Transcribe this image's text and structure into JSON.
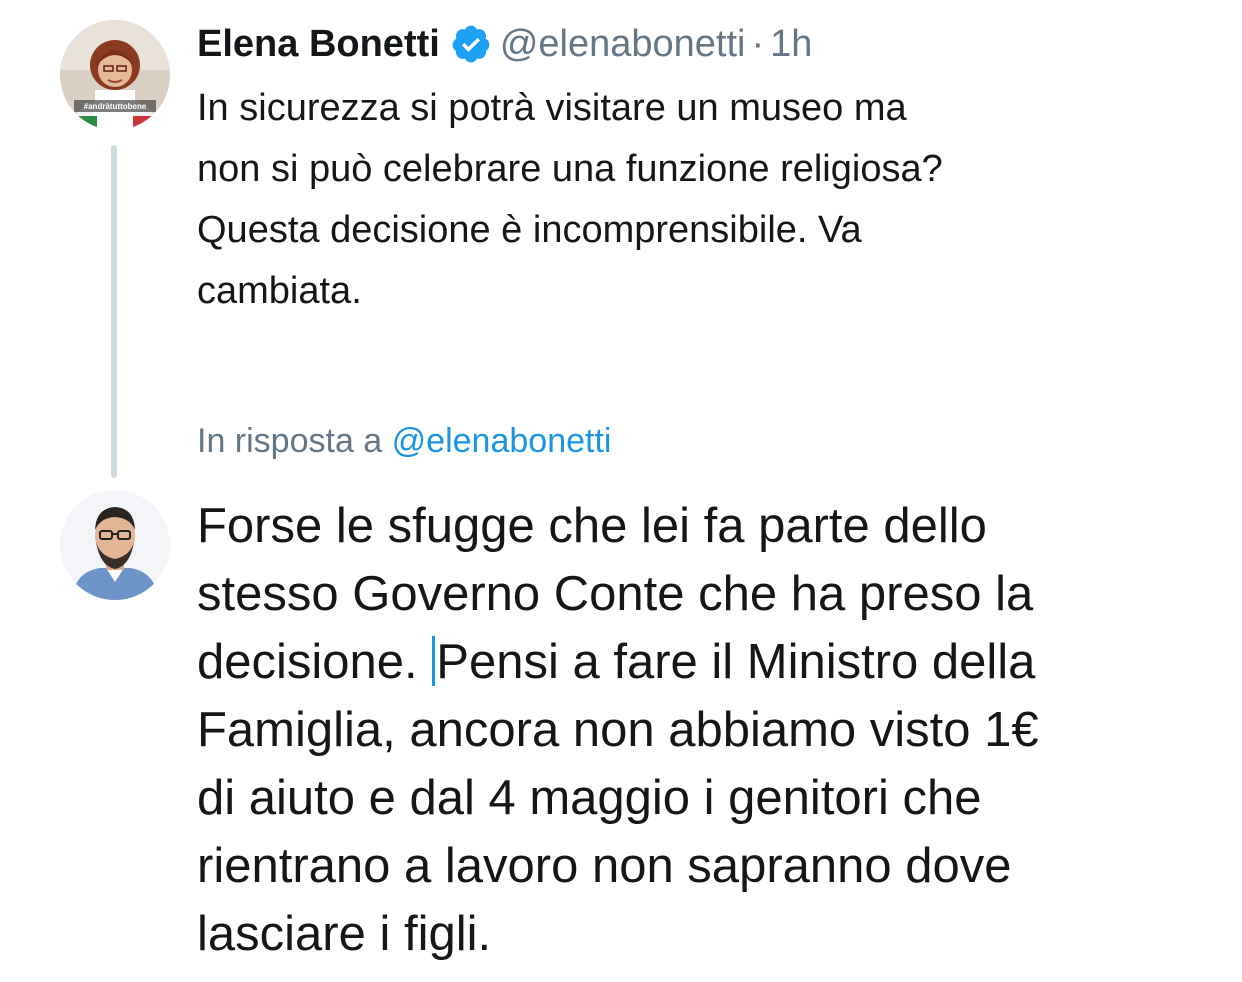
{
  "tweet": {
    "author_name": "Elena Bonetti",
    "author_handle": "@elenabonetti",
    "separator": "·",
    "timestamp": "1h",
    "avatar_overlay_text": "#andràtuttobene",
    "text_lines": [
      "In sicurezza si potrà visitare un museo ma",
      "non si può celebrare una funzione religiosa?",
      "Questa decisione è incomprensibile. Va",
      "cambiata."
    ]
  },
  "reply": {
    "context_prefix": "In risposta a",
    "context_mention": "@elenabonetti",
    "text_lines": [
      "Forse le sfugge che lei fa parte dello",
      "stesso Governo Conte che ha preso la",
      "decisione.",
      "Pensi a fare il Ministro della",
      "Famiglia, ancora non abbiamo visto 1€",
      "di aiuto e dal 4 maggio i genitori che",
      "rientrano a lavoro non sapranno dove",
      "lasciare i figli."
    ]
  },
  "icons": {
    "verified": "verified-badge-icon",
    "avatar_1": "author-avatar",
    "avatar_2": "reply-author-avatar"
  },
  "colors": {
    "text": "#14171a",
    "secondary_text": "#657786",
    "link": "#1b95e0",
    "verified": "#1da1f2",
    "thread_line": "#cfd9de"
  }
}
